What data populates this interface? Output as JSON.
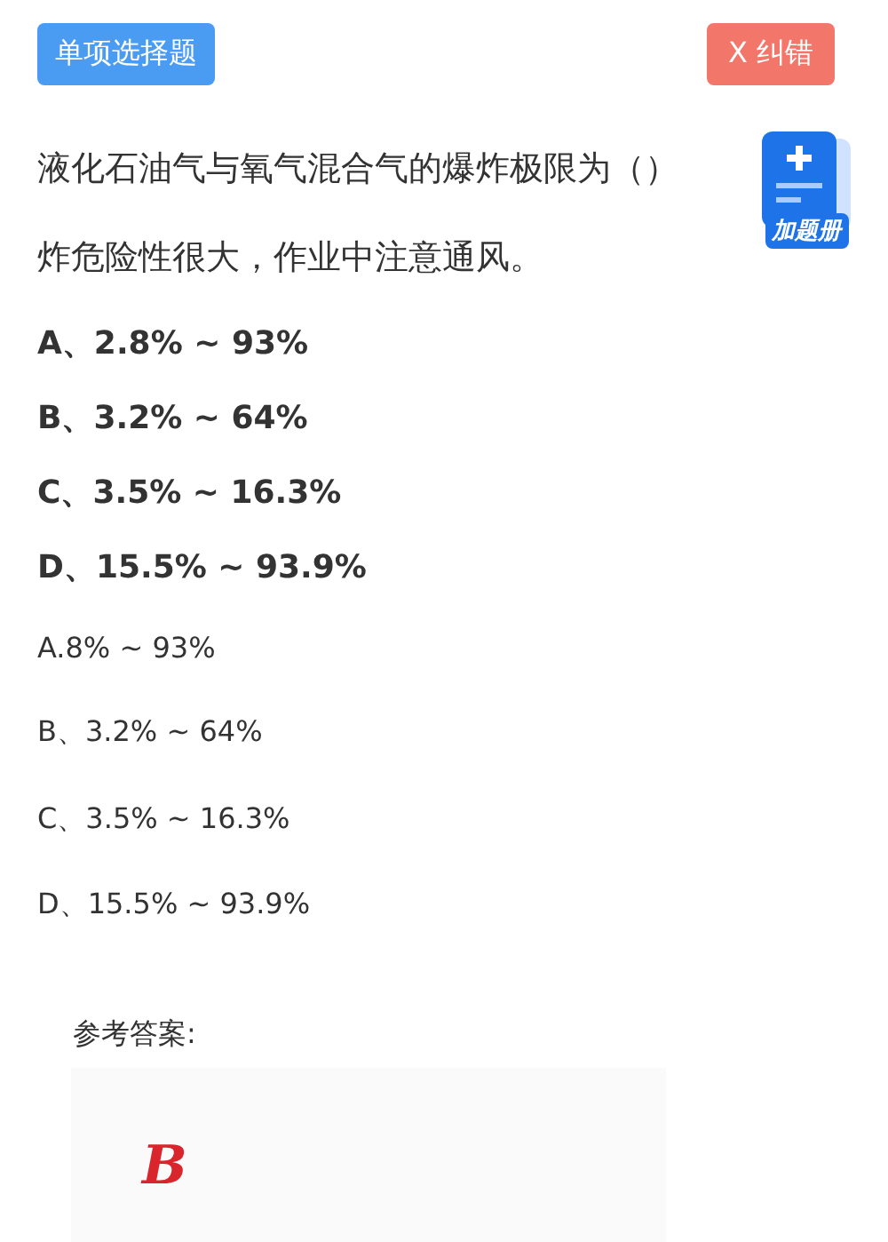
{
  "header": {
    "type_badge": "单项选择题",
    "report_button": "X 纠错"
  },
  "question": {
    "text": "液化石油气与氧气混合气的爆炸极限为（）炸危险性很大，作业中注意通风。"
  },
  "add_to_book": {
    "label": "加题册"
  },
  "options": [
    {
      "kind": "bold",
      "text": "A、2.8% ~ 93%"
    },
    {
      "kind": "bold",
      "text": "B、3.2% ~ 64%"
    },
    {
      "kind": "bold",
      "text": "C、3.5% ~ 16.3%"
    },
    {
      "kind": "bold",
      "text": "D、15.5% ~ 93.9%"
    },
    {
      "kind": "plain",
      "text": "A.8% ~ 93%"
    },
    {
      "kind": "plain",
      "text": "B、3.2% ~ 64%"
    },
    {
      "kind": "plain",
      "text": "C、3.5% ~ 16.3%"
    },
    {
      "kind": "plain",
      "text": "D、15.5% ~ 93.9%"
    }
  ],
  "answer": {
    "label": "参考答案:",
    "value": "B"
  }
}
